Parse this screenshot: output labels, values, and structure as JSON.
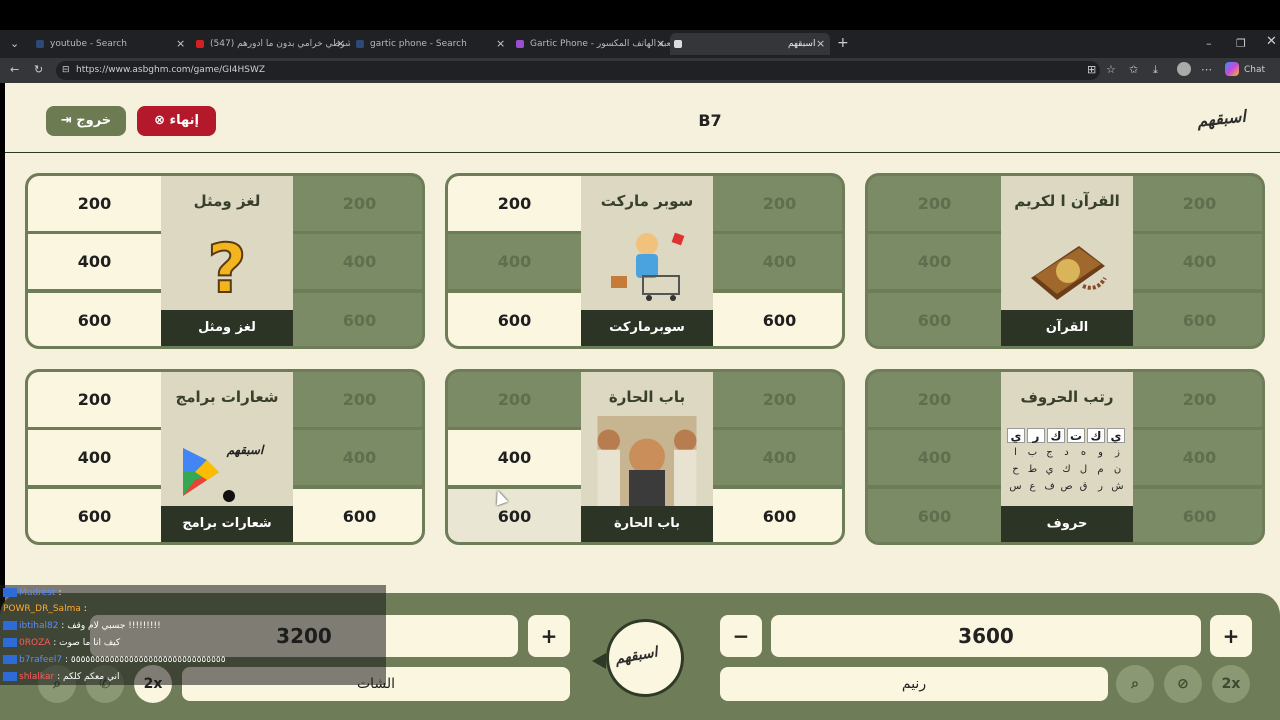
{
  "browser": {
    "tabs": [
      {
        "title": "youtube - Search"
      },
      {
        "title": "(547) شرطي خرامي بدون ما ادورهم !"
      },
      {
        "title": "gartic phone - Search"
      },
      {
        "title": "Gartic Phone - لعبة الهاتف المكسور"
      },
      {
        "title": "اسبقهم"
      }
    ],
    "new_tab": "+",
    "url": "https://www.asbghm.com/game/GI4HSWZ",
    "chat_button": "Chat"
  },
  "header": {
    "exit_label": "خروج",
    "end_label": "إنهاء",
    "game_code": "B7",
    "logo_text": "اسبقهم"
  },
  "boards": [
    {
      "title": "لغز ومثل",
      "caption": "لغز ومثل",
      "left": [
        {
          "v": "200",
          "s": "available"
        },
        {
          "v": "400",
          "s": "available"
        },
        {
          "v": "600",
          "s": "available"
        }
      ],
      "right": [
        {
          "v": "200",
          "s": "used"
        },
        {
          "v": "400",
          "s": "used"
        },
        {
          "v": "600",
          "s": "used"
        }
      ]
    },
    {
      "title": "سوبر ماركت",
      "caption": "سوبرماركت",
      "left": [
        {
          "v": "200",
          "s": "available"
        },
        {
          "v": "400",
          "s": "used"
        },
        {
          "v": "600",
          "s": "available"
        }
      ],
      "right": [
        {
          "v": "200",
          "s": "used"
        },
        {
          "v": "400",
          "s": "used"
        },
        {
          "v": "600",
          "s": "available"
        }
      ]
    },
    {
      "title": "القرآن ا لكريم",
      "caption": "القرآن",
      "left": [
        {
          "v": "200",
          "s": "used"
        },
        {
          "v": "400",
          "s": "used"
        },
        {
          "v": "600",
          "s": "used"
        }
      ],
      "right": [
        {
          "v": "200",
          "s": "used"
        },
        {
          "v": "400",
          "s": "used"
        },
        {
          "v": "600",
          "s": "used"
        }
      ]
    },
    {
      "title": "شعارات برامج",
      "caption": "شعارات برامج",
      "left": [
        {
          "v": "200",
          "s": "available"
        },
        {
          "v": "400",
          "s": "available"
        },
        {
          "v": "600",
          "s": "available"
        }
      ],
      "right": [
        {
          "v": "200",
          "s": "used"
        },
        {
          "v": "400",
          "s": "used"
        },
        {
          "v": "600",
          "s": "available"
        }
      ]
    },
    {
      "title": "باب الحارة",
      "caption": "باب الحارة",
      "left": [
        {
          "v": "200",
          "s": "used"
        },
        {
          "v": "400",
          "s": "available"
        },
        {
          "v": "600",
          "s": "hover"
        }
      ],
      "right": [
        {
          "v": "200",
          "s": "used"
        },
        {
          "v": "400",
          "s": "used"
        },
        {
          "v": "600",
          "s": "available"
        }
      ]
    },
    {
      "title": "رتب الحروف",
      "caption": "حروف",
      "left": [
        {
          "v": "200",
          "s": "used"
        },
        {
          "v": "400",
          "s": "used"
        },
        {
          "v": "600",
          "s": "used"
        }
      ],
      "right": [
        {
          "v": "200",
          "s": "used"
        },
        {
          "v": "400",
          "s": "used"
        },
        {
          "v": "600",
          "s": "used"
        }
      ]
    }
  ],
  "letters_grid": [
    "ي",
    "ر",
    "ك",
    "ت",
    "ك",
    "ي",
    "ا",
    "ب",
    "ج",
    "د",
    "ه",
    "و",
    "ز",
    "ح",
    "ط",
    "ي",
    "ك",
    "ل",
    "م",
    "ن",
    "س",
    "ع",
    "ف",
    "ص",
    "ق",
    "ر",
    "ش"
  ],
  "team_left": {
    "score": "3200",
    "name": "الشات",
    "plus": "+",
    "double": "2x"
  },
  "team_right": {
    "score": "3600",
    "name": "رنيم",
    "plus": "+",
    "minus": "−",
    "double": "2x"
  },
  "center_logo": "اسبقهم",
  "chat_messages": [
    {
      "user": "Mudrest",
      "text": ":"
    },
    {
      "user": "POWR_DR_Salma",
      "text": ":"
    },
    {
      "user": "ibtihal82",
      "text": ": جسبي لام وقف !!!!!!!!!"
    },
    {
      "user": "0ROZA",
      "text": ": كيف انا ما صوت"
    },
    {
      "user": "b7rafeel7",
      "text": ": ٥٥٥٥٥٥٥٥٥٥٥٥٥٥٥٥٥٥٥٥٥٥٥٥٥٥٥٥٥٥٥٥"
    },
    {
      "user": "shlalkar",
      "text": ": اني معكم كلكم"
    }
  ],
  "colors": {
    "olive": "#6d7d57",
    "cream": "#fbf6e0",
    "dark": "#2b3425",
    "end_red": "#b3182b"
  }
}
